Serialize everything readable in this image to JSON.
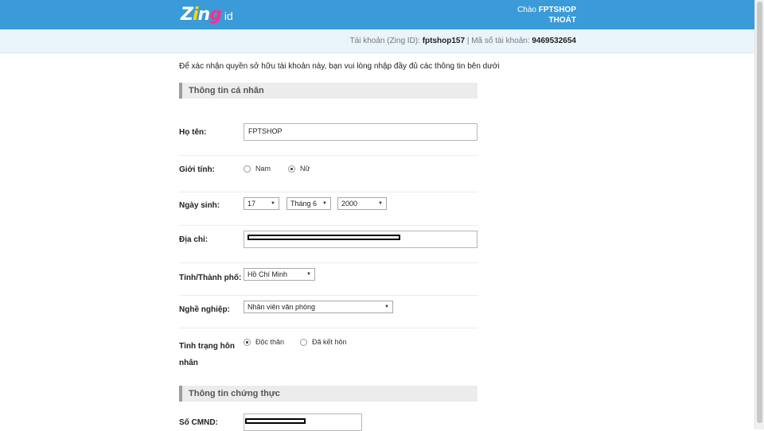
{
  "header": {
    "logo_text": "Zing",
    "logo_suffix": "id",
    "greeting_prefix": "Chào",
    "username": "FPTSHOP",
    "logout_label": "THOÁT"
  },
  "account": {
    "zing_id_label": "Tài khoản (Zing ID):",
    "zing_id_value": "fptshop157",
    "separator": "|",
    "account_no_label": "Mã số tài khoản:",
    "account_no_value": "9469532654"
  },
  "intro": "Để xác nhận quyền sở hữu tài khoản này, bạn vui lòng nhập đầy đủ các thông tin bên dưới",
  "sections": {
    "personal": "Thông tin cá nhân",
    "verification": "Thông tin chứng thực"
  },
  "fields": {
    "fullname": {
      "label": "Họ tên:",
      "value": "FPTSHOP"
    },
    "gender": {
      "label": "Giới tính:",
      "options": [
        "Nam",
        "Nữ"
      ],
      "selected": "Nữ"
    },
    "birthday": {
      "label": "Ngày sinh:",
      "day": "17",
      "month": "Tháng 6",
      "year": "2000"
    },
    "address": {
      "label": "Địa chỉ:"
    },
    "city": {
      "label": "Tỉnh/Thành phố:",
      "value": "Hồ Chí Minh"
    },
    "job": {
      "label": "Nghề nghiệp:",
      "value": "Nhân viên văn phòng"
    },
    "marital": {
      "label_line1": "Tình trạng hôn",
      "label_line2": "nhân",
      "options": [
        "Độc thân",
        "Đã kết hôn"
      ],
      "selected": "Độc thân"
    },
    "id_number": {
      "label": "Số CMND:"
    }
  },
  "icons": {
    "dropdown": "dropdown-arrow-icon",
    "arrow_glyph": "▼"
  }
}
